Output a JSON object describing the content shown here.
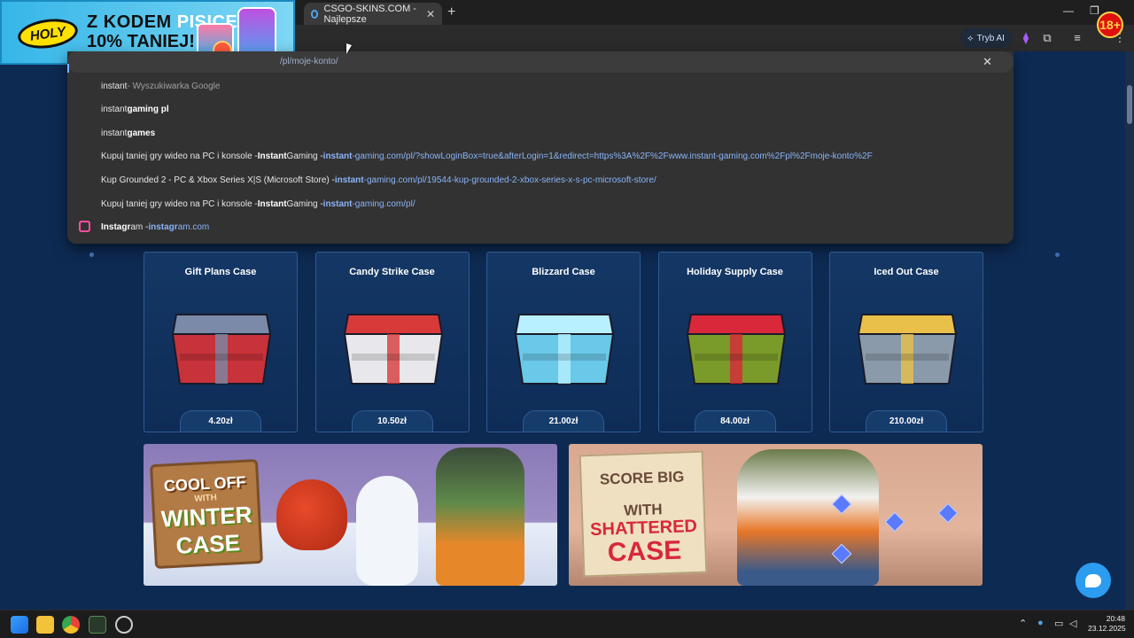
{
  "browser": {
    "tab": {
      "title": "CSGO-SKINS.COM - Najlepsze"
    },
    "toolbar": {
      "ai_mode_label": "Tryb AI"
    },
    "age_badge": "18+"
  },
  "ad": {
    "brand": "HOLY",
    "line1_dark": "Z KODEM",
    "line1_highlight": "PISICELA",
    "line2": "10% TANIEJ!"
  },
  "omnibox": {
    "url_tail": "/pl/moje-konto/",
    "suggestions": [
      {
        "icon": "search-icon",
        "parts": [
          {
            "t": "instant",
            "s": "plain"
          },
          {
            "t": " - Wyszukiwarka Google",
            "s": "dim"
          }
        ]
      },
      {
        "icon": "search-icon",
        "parts": [
          {
            "t": "instant ",
            "s": "plain"
          },
          {
            "t": "gaming pl",
            "s": "bold"
          }
        ]
      },
      {
        "icon": "search-icon",
        "parts": [
          {
            "t": "instant ",
            "s": "plain"
          },
          {
            "t": "games",
            "s": "bold"
          }
        ]
      },
      {
        "icon": "instant-gaming-icon",
        "parts": [
          {
            "t": "Kupuj taniej gry wideo na PC i konsole - ",
            "s": "plain"
          },
          {
            "t": "Instant",
            "s": "bold"
          },
          {
            "t": " Gaming - ",
            "s": "plain"
          },
          {
            "t": "instant",
            "s": "linkbold"
          },
          {
            "t": "-gaming.com/pl/?showLoginBox=true&afterLogin=1&redirect=https%3A%2F%2Fwww.instant-gaming.com%2Fpl%2Fmoje-konto%2F",
            "s": "link"
          }
        ]
      },
      {
        "icon": "instant-gaming-icon",
        "parts": [
          {
            "t": "Kup Grounded 2 - PC & Xbox Series X|S (Microsoft Store) - ",
            "s": "plain"
          },
          {
            "t": "instant",
            "s": "linkbold"
          },
          {
            "t": "-gaming.com/pl/19544-kup-grounded-2-xbox-series-x-s-pc-microsoft-store/",
            "s": "link"
          }
        ]
      },
      {
        "icon": "instant-gaming-icon",
        "parts": [
          {
            "t": "Kupuj taniej gry wideo na PC i konsole - ",
            "s": "plain"
          },
          {
            "t": "Instant",
            "s": "bold"
          },
          {
            "t": " Gaming - ",
            "s": "plain"
          },
          {
            "t": "instant",
            "s": "linkbold"
          },
          {
            "t": "-gaming.com/pl/",
            "s": "link"
          }
        ]
      },
      {
        "icon": "instagram-icon",
        "parts": [
          {
            "t": "Instagr",
            "s": "bold"
          },
          {
            "t": "am - ",
            "s": "plain"
          },
          {
            "t": "instagr",
            "s": "linkbold"
          },
          {
            "t": "am.com",
            "s": "link"
          }
        ]
      }
    ]
  },
  "cases": [
    {
      "name": "Gift Plans Case",
      "price": "4.20zł",
      "color": "#c8323a",
      "accent": "#7a8aa8"
    },
    {
      "name": "Candy Strike Case",
      "price": "10.50zł",
      "color": "#e8e8ec",
      "accent": "#d83a3a"
    },
    {
      "name": "Blizzard Case",
      "price": "21.00zł",
      "color": "#6ac8e8",
      "accent": "#b8f0ff"
    },
    {
      "name": "Holiday Supply Case",
      "price": "84.00zł",
      "color": "#7a9a2a",
      "accent": "#d8283a"
    },
    {
      "name": "Iced Out Case",
      "price": "210.00zł",
      "color": "#8a9aaa",
      "accent": "#e8c04a"
    }
  ],
  "promos": {
    "winter": {
      "line1": "COOL OFF",
      "line2": "WITH",
      "line3": "WINTER",
      "line4": "CASE"
    },
    "shattered": {
      "line1": "SCORE BIG",
      "line2": "WITH",
      "line3": "SHATTERED",
      "line4": "CASE"
    }
  },
  "taskbar": {
    "time": "20:48",
    "date": "23.12.2025"
  }
}
